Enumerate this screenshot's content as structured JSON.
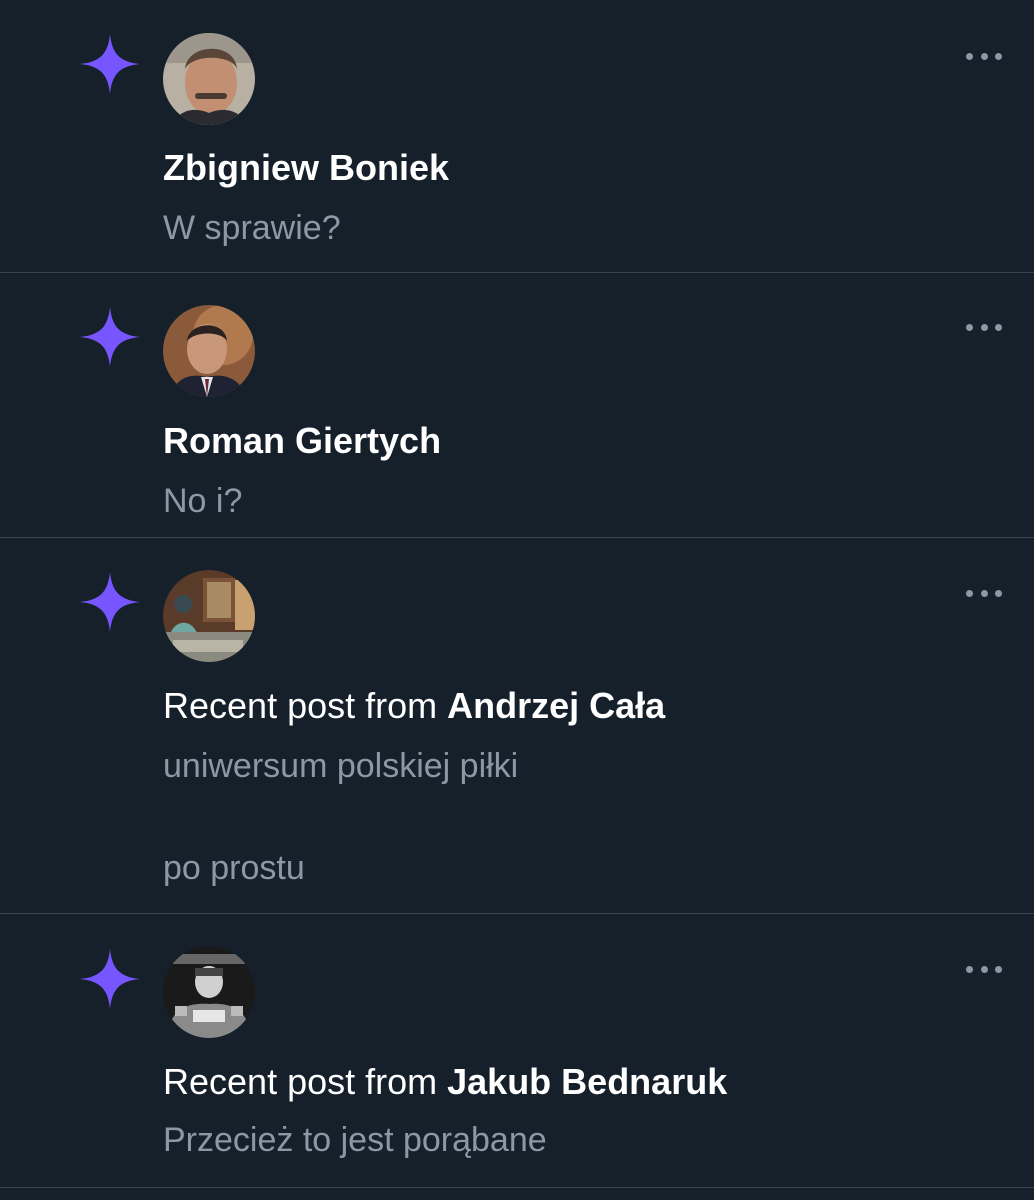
{
  "theme": {
    "background": "#15202b",
    "divider": "#38444d",
    "star_color": "#7856ff",
    "secondary_text": "#8b98a5",
    "primary_text": "#ffffff"
  },
  "notifications": [
    {
      "icon": "sparkle-star-icon",
      "name": "Zbigniew Boniek",
      "prefix": "",
      "lines": [
        "W sprawie?"
      ]
    },
    {
      "icon": "sparkle-star-icon",
      "name": "Roman Giertych",
      "prefix": "",
      "lines": [
        "No i?"
      ]
    },
    {
      "icon": "sparkle-star-icon",
      "name": "Andrzej Cała",
      "prefix": "Recent post from ",
      "lines": [
        "uniwersum polskiej piłki",
        "po prostu"
      ]
    },
    {
      "icon": "sparkle-star-icon",
      "name": "Jakub Bednaruk",
      "prefix": "Recent post from ",
      "lines": [
        "Przecież to jest porąbane"
      ]
    }
  ]
}
